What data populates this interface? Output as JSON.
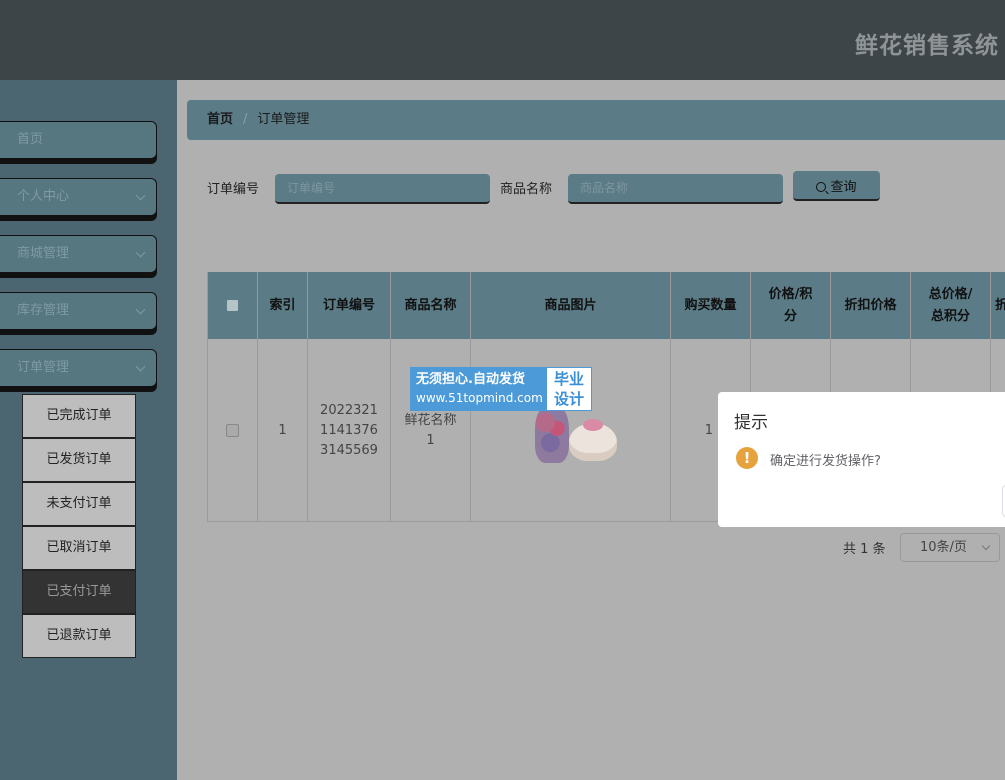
{
  "header": {
    "title": "鲜花销售系统"
  },
  "sidebar": {
    "items": [
      {
        "label": "首页",
        "has_chevron": false
      },
      {
        "label": "个人中心",
        "has_chevron": true
      },
      {
        "label": "商城管理",
        "has_chevron": true
      },
      {
        "label": "库存管理",
        "has_chevron": true
      },
      {
        "label": "订单管理",
        "has_chevron": true,
        "expanded": true
      }
    ],
    "submenu": [
      {
        "label": "已完成订单"
      },
      {
        "label": "已发货订单"
      },
      {
        "label": "未支付订单"
      },
      {
        "label": "已取消订单"
      },
      {
        "label": "已支付订单",
        "active": true
      },
      {
        "label": "已退款订单"
      }
    ]
  },
  "breadcrumb": {
    "home": "首页",
    "separator": "/",
    "current": "订单管理"
  },
  "search": {
    "order_no_label": "订单编号",
    "order_no_placeholder": "订单编号",
    "product_name_label": "商品名称",
    "product_name_placeholder": "商品名称",
    "button_label": "查询"
  },
  "table": {
    "headers": {
      "index": "索引",
      "order_no": "订单编号",
      "product_name": "商品名称",
      "product_image": "商品图片",
      "quantity": "购买数量",
      "price_l1": "价格/积",
      "price_l2": "分",
      "discount_price": "折扣价格",
      "total_l1": "总价格/",
      "total_l2": "总积分",
      "next_partial": "折"
    },
    "row": {
      "index": "1",
      "order_no_l1": "2022321",
      "order_no_l2": "1141376",
      "order_no_l3": "3145569",
      "product_name_l1": "鲜花名称",
      "product_name_l2": "1",
      "quantity": "1"
    }
  },
  "watermark": {
    "line1": "无须担心.自动发货",
    "line2": "www.51topmind.com",
    "badge_l1": "毕业",
    "badge_l2": "设计"
  },
  "pagination": {
    "total_text": "共 1 条",
    "page_size": "10条/页"
  },
  "dialog": {
    "title": "提示",
    "message": "确定进行发货操作?",
    "icon": "warning-icon"
  },
  "colors": {
    "accent": "#5b7b86",
    "header_bg": "#3e4548",
    "sidebar_bg": "#4b6670",
    "warning": "#e6a23c",
    "watermark_blue": "#4c9ad8"
  }
}
